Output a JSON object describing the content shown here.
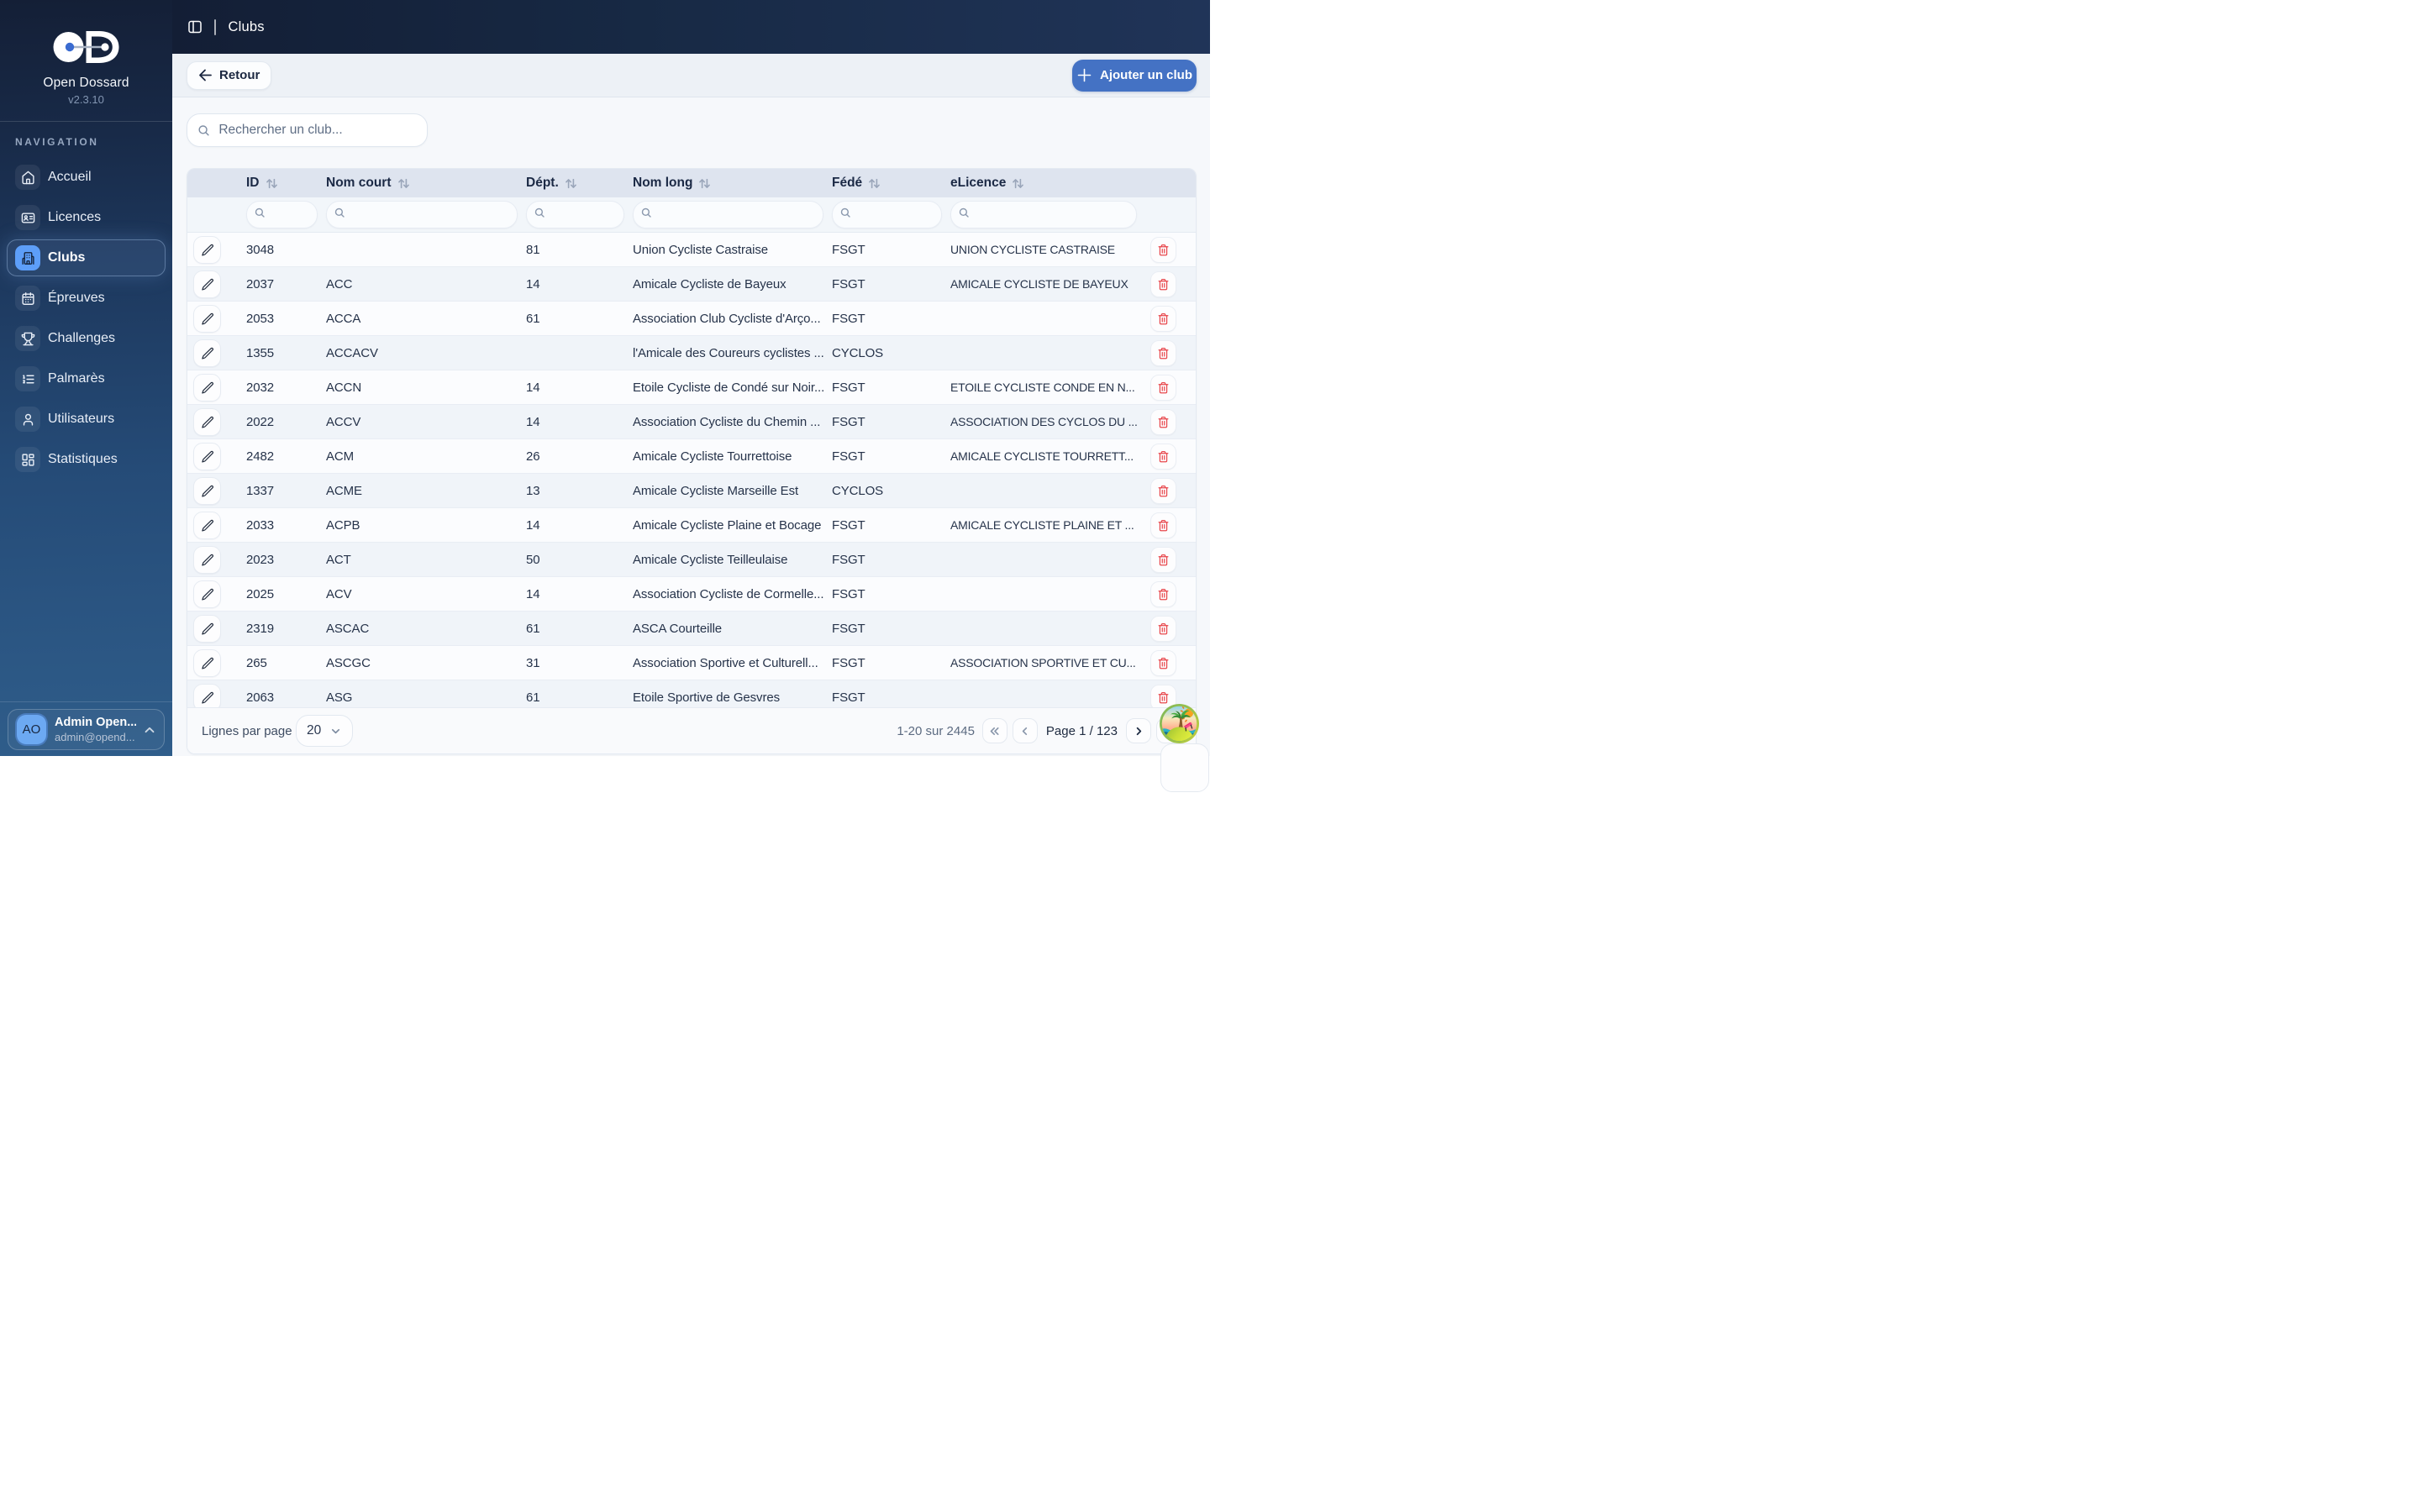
{
  "app": {
    "name": "Open Dossard",
    "version": "v2.3.10"
  },
  "sidebar": {
    "section_label": "NAVIGATION",
    "items": [
      {
        "label": "Accueil",
        "icon": "home-icon",
        "active": false
      },
      {
        "label": "Licences",
        "icon": "id-card-icon",
        "active": false
      },
      {
        "label": "Clubs",
        "icon": "building-icon",
        "active": true
      },
      {
        "label": "Épreuves",
        "icon": "calendar-icon",
        "active": false
      },
      {
        "label": "Challenges",
        "icon": "trophy-icon",
        "active": false
      },
      {
        "label": "Palmarès",
        "icon": "list-ordered-icon",
        "active": false
      },
      {
        "label": "Utilisateurs",
        "icon": "user-icon",
        "active": false
      },
      {
        "label": "Statistiques",
        "icon": "layout-dashboard-icon",
        "active": false
      }
    ],
    "user": {
      "initials": "AO",
      "name": "Admin Open...",
      "email": "admin@opend..."
    }
  },
  "header": {
    "title": "Clubs",
    "toggle_icon": "panel-left-icon"
  },
  "toolbar": {
    "back_label": "Retour",
    "add_label": "Ajouter un club"
  },
  "search": {
    "placeholder": "Rechercher un club...",
    "value": "",
    "icon": "search-icon"
  },
  "table": {
    "columns": [
      {
        "key": "id",
        "label": "ID",
        "sortable": true
      },
      {
        "key": "nom_court",
        "label": "Nom court",
        "sortable": true
      },
      {
        "key": "dept",
        "label": "Dépt.",
        "sortable": true
      },
      {
        "key": "nom_long",
        "label": "Nom long",
        "sortable": true
      },
      {
        "key": "fede",
        "label": "Fédé",
        "sortable": true
      },
      {
        "key": "elicence",
        "label": "eLicence",
        "sortable": true
      }
    ],
    "rows": [
      {
        "id": "3048",
        "nom_court": "",
        "dept": "81",
        "nom_long": "Union Cycliste Castraise",
        "fede": "FSGT",
        "elicence": "UNION CYCLISTE CASTRAISE"
      },
      {
        "id": "2037",
        "nom_court": "ACC",
        "dept": "14",
        "nom_long": "Amicale Cycliste de Bayeux",
        "fede": "FSGT",
        "elicence": "AMICALE CYCLISTE DE BAYEUX"
      },
      {
        "id": "2053",
        "nom_court": "ACCA",
        "dept": "61",
        "nom_long": "Association Club Cycliste d'Arço...",
        "fede": "FSGT",
        "elicence": ""
      },
      {
        "id": "1355",
        "nom_court": "ACCACV",
        "dept": "",
        "nom_long": "l'Amicale des Coureurs cyclistes ...",
        "fede": "CYCLOS",
        "elicence": ""
      },
      {
        "id": "2032",
        "nom_court": "ACCN",
        "dept": "14",
        "nom_long": "Etoile Cycliste de Condé sur Noir...",
        "fede": "FSGT",
        "elicence": "ETOILE CYCLISTE CONDE EN N..."
      },
      {
        "id": "2022",
        "nom_court": "ACCV",
        "dept": "14",
        "nom_long": "Association Cycliste du Chemin ...",
        "fede": "FSGT",
        "elicence": "ASSOCIATION DES CYCLOS DU ..."
      },
      {
        "id": "2482",
        "nom_court": "ACM",
        "dept": "26",
        "nom_long": "Amicale Cycliste Tourrettoise",
        "fede": "FSGT",
        "elicence": "AMICALE CYCLISTE TOURRETT..."
      },
      {
        "id": "1337",
        "nom_court": "ACME",
        "dept": "13",
        "nom_long": "Amicale Cycliste Marseille Est",
        "fede": "CYCLOS",
        "elicence": ""
      },
      {
        "id": "2033",
        "nom_court": "ACPB",
        "dept": "14",
        "nom_long": "Amicale Cycliste Plaine et Bocage",
        "fede": "FSGT",
        "elicence": "AMICALE CYCLISTE PLAINE ET ..."
      },
      {
        "id": "2023",
        "nom_court": "ACT",
        "dept": "50",
        "nom_long": "Amicale Cycliste Teilleulaise",
        "fede": "FSGT",
        "elicence": ""
      },
      {
        "id": "2025",
        "nom_court": "ACV",
        "dept": "14",
        "nom_long": "Association Cycliste de Cormelle...",
        "fede": "FSGT",
        "elicence": ""
      },
      {
        "id": "2319",
        "nom_court": "ASCAC",
        "dept": "61",
        "nom_long": "ASCA Courteille",
        "fede": "FSGT",
        "elicence": ""
      },
      {
        "id": "265",
        "nom_court": "ASCGC",
        "dept": "31",
        "nom_long": "Association Sportive et Culturell...",
        "fede": "FSGT",
        "elicence": "ASSOCIATION SPORTIVE ET CU..."
      },
      {
        "id": "2063",
        "nom_court": "ASG",
        "dept": "61",
        "nom_long": "Etoile Sportive de Gesvres",
        "fede": "FSGT",
        "elicence": ""
      }
    ]
  },
  "pagination": {
    "rows_per_page_label": "Lignes par page",
    "page_size": "20",
    "range_label": "1-20 sur 2445",
    "page_label": "Page 1 / 123",
    "first_icon": "chevrons-left-icon",
    "prev_icon": "chevron-left-icon",
    "next_icon": "chevron-right-icon",
    "last_icon": "chevrons-right-icon"
  },
  "floating_badge": {
    "icon": "desert-island-icon"
  },
  "colors": {
    "accent": "#4472c4",
    "active_icon_bg": "#5d9ef8",
    "danger": "#e8474c",
    "sidebar_top": "#141f36",
    "sidebar_bottom": "#2f5d8a",
    "table_header_bg": "#dee4ef"
  }
}
